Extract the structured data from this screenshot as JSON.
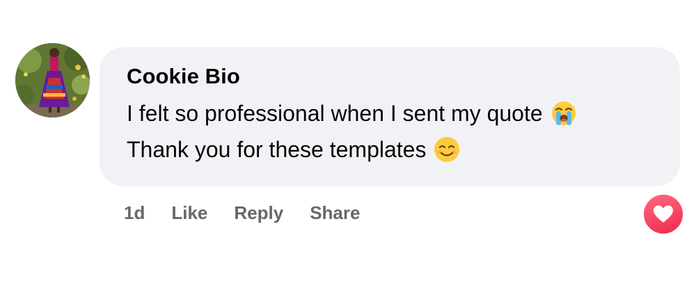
{
  "comment": {
    "author": "Cookie Bio",
    "line1": "I felt so professional when I sent my quote",
    "line1_emoji": "loudly-crying-face-emoji",
    "line2": "Thank you for these templates",
    "line2_emoji": "smiling-face-with-smiling-eyes-emoji"
  },
  "actions": {
    "timestamp": "1d",
    "like_label": "Like",
    "reply_label": "Reply",
    "share_label": "Share"
  },
  "reaction": {
    "icon": "heart-icon",
    "color": "#f02849"
  },
  "colors": {
    "bubble_bg": "#f0f2f5",
    "text": "#050505",
    "secondary_text": "#65676b"
  }
}
